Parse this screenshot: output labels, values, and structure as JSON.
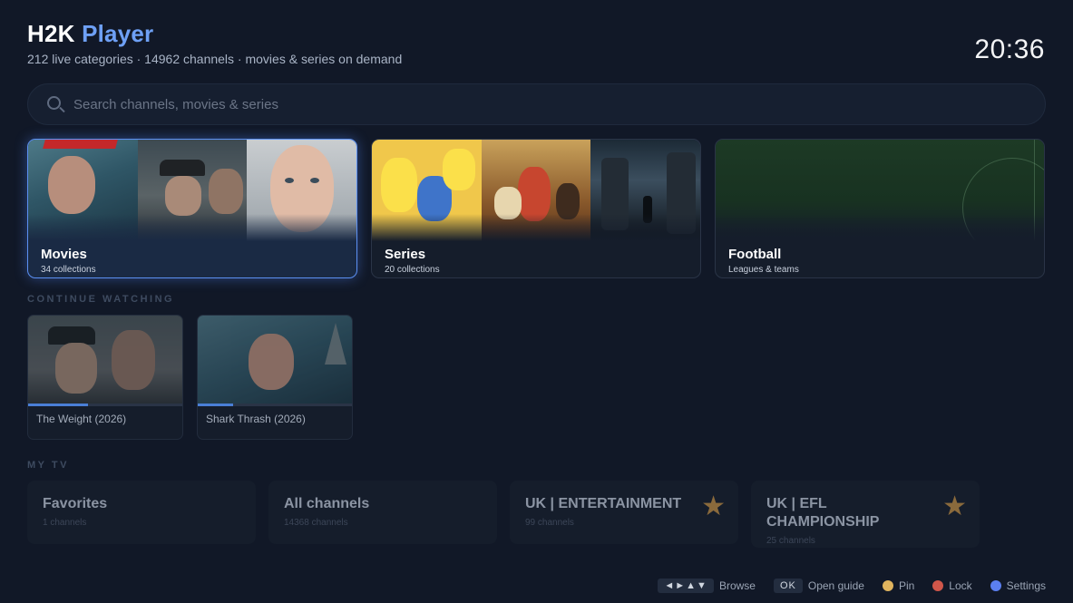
{
  "header": {
    "title_main": "H2K",
    "title_accent": "Player",
    "subtitle": "212 live categories · 14962 channels · movies & series on demand",
    "clock": "20:36"
  },
  "search": {
    "placeholder": "Search channels, movies & series"
  },
  "categories": [
    {
      "title": "Movies",
      "subtitle": "34 collections",
      "selected": true
    },
    {
      "title": "Series",
      "subtitle": "20 collections",
      "selected": false
    },
    {
      "title": "Football",
      "subtitle": "Leagues & teams",
      "selected": false
    }
  ],
  "continue_watching": {
    "label": "CONTINUE WATCHING",
    "items": [
      {
        "title": "The Weight (2026)",
        "progress": 0.39
      },
      {
        "title": "Shark Thrash (2026)",
        "progress": 0.23
      }
    ]
  },
  "my_tv": {
    "label": "MY TV",
    "items": [
      {
        "title": "Favorites",
        "subtitle": "1 channels",
        "pinned": false
      },
      {
        "title": "All channels",
        "subtitle": "14368 channels",
        "pinned": false
      },
      {
        "title": "UK | ENTERTAINMENT",
        "subtitle": "99 channels",
        "pinned": true
      },
      {
        "title": "UK | EFL CHAMPIONSHIP",
        "subtitle": "25 channels",
        "pinned": true
      }
    ]
  },
  "footer": {
    "arrows_key": "◄►▲▼",
    "browse_label": "Browse",
    "ok_key": "OK",
    "open_guide_label": "Open guide",
    "pin_label": "Pin",
    "lock_label": "Lock",
    "settings_label": "Settings",
    "pin_color": "#e0b45e",
    "lock_color": "#d0564a",
    "settings_color": "#5b7ff0"
  },
  "colors": {
    "accent": "#6ea0f5",
    "background": "#111827",
    "star": "#8a6a3c"
  },
  "icons": {
    "search": "search-icon",
    "pin_star": "star-icon"
  }
}
